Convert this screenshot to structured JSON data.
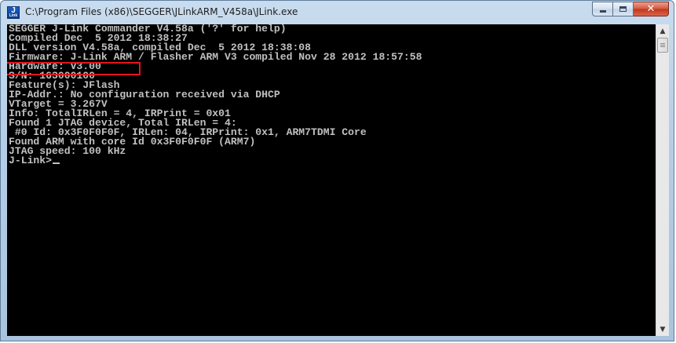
{
  "window": {
    "title": "C:\\Program Files (x86)\\SEGGER\\JLinkARM_V458a\\JLink.exe",
    "icon": "jlink-app-icon",
    "icon_text_top": "J",
    "icon_text_bottom": "Link",
    "controls": {
      "minimize": "minimize-icon",
      "maximize": "maximize-icon",
      "close": "close-icon",
      "close_glyph": "✕"
    }
  },
  "console": {
    "lines": [
      "SEGGER J-Link Commander V4.58a ('?' for help)",
      "Compiled Dec  5 2012 18:38:27",
      "DLL version V4.58a, compiled Dec  5 2012 18:38:08",
      "Firmware: J-Link ARM / Flasher ARM V3 compiled Nov 28 2012 18:57:58",
      "Hardware: V3.00",
      "S/N: 163000100",
      "Feature(s): JFlash",
      "IP-Addr.: No configuration received via DHCP",
      "VTarget = 3.267V",
      "Info: TotalIRLen = 4, IRPrint = 0x01",
      "Found 1 JTAG device, Total IRLen = 4:",
      " #0 Id: 0x3F0F0F0F, IRLen: 04, IRPrint: 0x1, ARM7TDMI Core",
      "Found ARM with core Id 0x3F0F0F0F (ARM7)",
      "JTAG speed: 100 kHz",
      "J-Link>"
    ],
    "highlighted_line": "Hardware: V3.00",
    "highlight_color": "#e5161c",
    "text_color": "#c0c0c0",
    "background": "#000000"
  },
  "scrollbar": {
    "up": "▲",
    "down": "▼"
  }
}
